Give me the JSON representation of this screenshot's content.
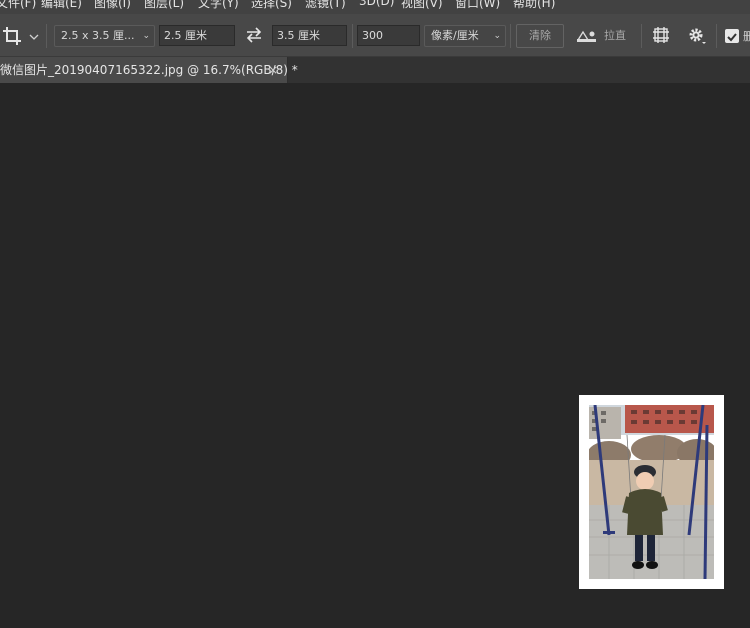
{
  "menu": {
    "items": [
      "文件(F)",
      "编辑(E)",
      "图像(I)",
      "图层(L)",
      "文字(Y)",
      "选择(S)",
      "滤镜(T)",
      "3D(D)",
      "视图(V)",
      "窗口(W)",
      "帮助(H)"
    ]
  },
  "options": {
    "crop_tool_icon": "crop-icon",
    "preset_label": "2.5 x 3.5 厘...",
    "width_value": "2.5 厘米",
    "swap_icon": "swap-arrows-icon",
    "height_value": "3.5 厘米",
    "resolution_value": "300",
    "resolution_unit": "像素/厘米",
    "clear_label": "清除",
    "straighten_label": "拉直",
    "straighten_icon": "level-icon",
    "overlay_icon": "grid-icon",
    "settings_icon": "gear-icon",
    "delete_cropped_checked": true,
    "delete_cropped_partial": "删"
  },
  "tab": {
    "title": "微信图片_20190407165322.jpg @ 16.7%(RGB/8) *",
    "close": "×"
  },
  "colors": {
    "canvas_bg": "#262626",
    "toolbar_bg": "#484848",
    "tab_active": "#4a4a4a"
  }
}
